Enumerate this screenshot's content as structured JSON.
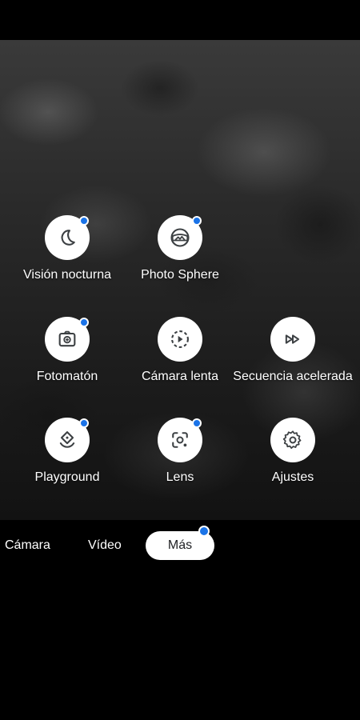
{
  "modes": [
    {
      "label": "Visión nocturna",
      "icon": "moon-icon",
      "has_badge": true
    },
    {
      "label": "Photo Sphere",
      "icon": "photo-sphere-icon",
      "has_badge": true
    },
    {
      "label": "Fotomatón",
      "icon": "photobooth-icon",
      "has_badge": true
    },
    {
      "label": "Cámara lenta",
      "icon": "slow-motion-icon",
      "has_badge": false
    },
    {
      "label": "Secuencia acelerada",
      "icon": "fast-forward-icon",
      "has_badge": false
    },
    {
      "label": "Playground",
      "icon": "playground-icon",
      "has_badge": true
    },
    {
      "label": "Lens",
      "icon": "lens-icon",
      "has_badge": true
    },
    {
      "label": "Ajustes",
      "icon": "gear-icon",
      "has_badge": false
    }
  ],
  "tabs": {
    "camera": "Cámara",
    "video": "Vídeo",
    "more": "Más"
  },
  "colors": {
    "badge": "#1a73e8",
    "icon": "#3c4043",
    "background": "#000000"
  }
}
